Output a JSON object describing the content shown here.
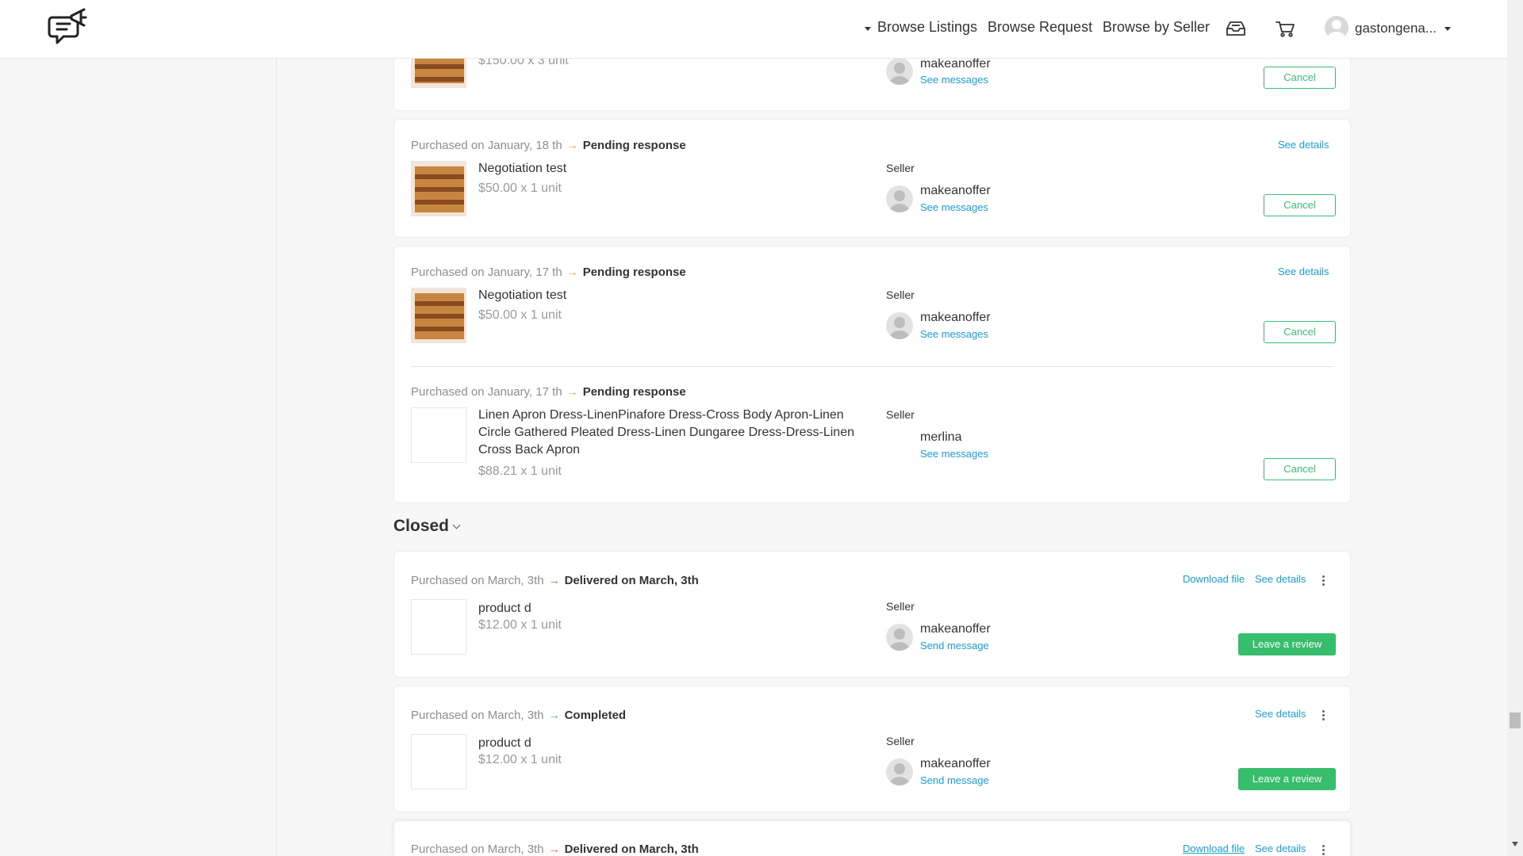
{
  "header": {
    "nav": [
      "Browse Listings",
      "Browse Request",
      "Browse by Seller"
    ],
    "username": "gastongena...",
    "icons": [
      "logo-chat-megaphone-icon",
      "inbox-icon",
      "cart-icon",
      "avatar",
      "chevron-down-icon"
    ]
  },
  "pending_orders": [
    {
      "purchased": "",
      "status": "",
      "title": "",
      "price": "$150.00 x 3 unit",
      "seller_label": "",
      "seller": "makeanoffer",
      "message_link": "See messages",
      "details_link": "",
      "action": "Cancel"
    },
    {
      "purchased": "Purchased on January, 18 th",
      "status": "Pending response",
      "title": "Negotiation test",
      "price": "$50.00 x 1 unit",
      "seller_label": "Seller",
      "seller": "makeanoffer",
      "message_link": "See messages",
      "details_link": "See details",
      "action": "Cancel"
    },
    {
      "purchased": "Purchased on January, 17 th",
      "status": "Pending response",
      "title": "Negotiation test",
      "price": "$50.00 x 1 unit",
      "seller_label": "Seller",
      "seller": "makeanoffer",
      "message_link": "See messages",
      "details_link": "See details",
      "action": "Cancel"
    },
    {
      "purchased": "Purchased on January, 17 th",
      "status": "Pending response",
      "title": "Linen Apron Dress-LinenPinafore Dress-Cross Body Apron-Linen Circle Gathered Pleated Dress-Linen Dungaree Dress-Dress-Linen Cross Back Apron",
      "price": "$88.21 x 1 unit",
      "seller_label": "Seller",
      "seller": "merlina",
      "message_link": "See messages",
      "details_link": "",
      "action": "Cancel"
    }
  ],
  "closed_section": {
    "title": "Closed"
  },
  "closed_orders": [
    {
      "purchased": "Purchased on March, 3th",
      "status": "Delivered on March, 3th",
      "title": "product d",
      "price": "$12.00 x 1 unit",
      "seller_label": "Seller",
      "seller": "makeanoffer",
      "message_link": "Send message",
      "download_link": "Download file",
      "details_link": "See details",
      "action": "Leave a review"
    },
    {
      "purchased": "Purchased on March, 3th",
      "status": "Completed",
      "title": "product d",
      "price": "$12.00 x 1 unit",
      "seller_label": "Seller",
      "seller": "makeanoffer",
      "message_link": "Send message",
      "download_link": "",
      "details_link": "See details",
      "action": "Leave a review"
    },
    {
      "purchased": "Purchased on March, 3th",
      "status": "Delivered on March, 3th",
      "download_link": "Download file",
      "details_link": "See details"
    }
  ],
  "colors": {
    "accent_green": "#37be6c",
    "link_blue": "#1a9fd9",
    "arrow_orange": "#f0a030",
    "arrow_red": "#e0514a",
    "arrow_green": "#37be6c"
  }
}
